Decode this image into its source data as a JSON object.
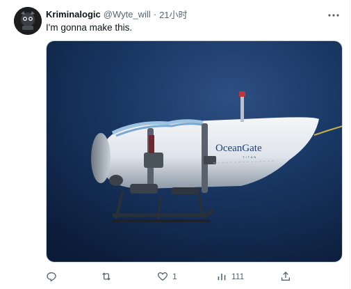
{
  "tweet": {
    "display_name": "Kriminalogic",
    "handle": "@Wyte_will",
    "separator": "·",
    "timestamp": "21小时",
    "text": "I'm gonna make this.",
    "media": {
      "logo_text": "OceanGate",
      "logo_subtext": "TITAN"
    },
    "actions": {
      "replies": "",
      "reposts": "",
      "likes": "1",
      "views": "111"
    }
  },
  "colors": {
    "text_primary": "#0f1419",
    "text_secondary": "#536471",
    "ocean_deep": "#0b1a36",
    "ocean_light": "#2d4f82"
  },
  "icons": {
    "more": "more-icon",
    "reply": "reply-icon",
    "repost": "repost-icon",
    "like": "heart-icon",
    "views": "views-icon",
    "share": "share-icon"
  }
}
